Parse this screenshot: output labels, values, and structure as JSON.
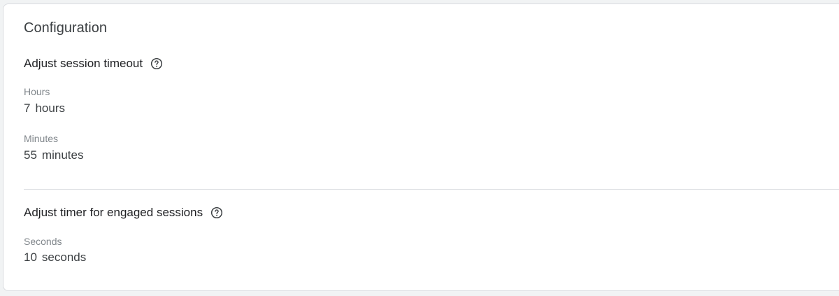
{
  "card": {
    "title": "Configuration"
  },
  "session_timeout": {
    "heading": "Adjust session timeout",
    "help_icon": "help-circle-icon",
    "hours": {
      "label": "Hours",
      "value": "7",
      "unit": "hours"
    },
    "minutes": {
      "label": "Minutes",
      "value": "55",
      "unit": "minutes"
    }
  },
  "engaged_sessions": {
    "heading": "Adjust timer for engaged sessions",
    "help_icon": "help-circle-icon",
    "seconds": {
      "label": "Seconds",
      "value": "10",
      "unit": "seconds"
    }
  }
}
